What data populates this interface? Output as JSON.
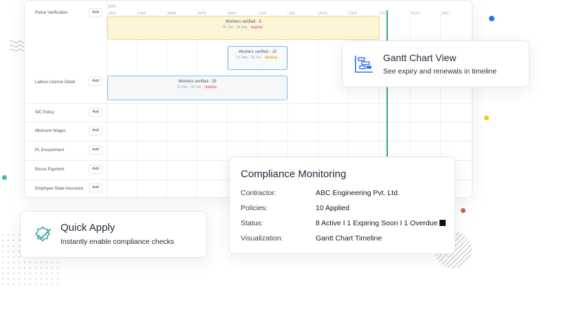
{
  "gantt": {
    "year": "2025",
    "months": [
      "JAN",
      "FEB",
      "MAR",
      "APR",
      "MAY",
      "JUN",
      "JUL",
      "AUG",
      "SEP",
      "OCT",
      "NOV",
      "DEC"
    ],
    "rows": [
      {
        "label": "Police Verification",
        "add": "Add"
      },
      {
        "label": "Labour License Detail",
        "add": "Add"
      },
      {
        "label": "WC Policy",
        "add": "Add"
      },
      {
        "label": "Minimum Wages",
        "add": "Add"
      },
      {
        "label": "PL Encashment",
        "add": "Add"
      },
      {
        "label": "Bonus Payment",
        "add": "Add"
      },
      {
        "label": "Employee State Insurance",
        "add": "Add"
      }
    ],
    "bars": [
      {
        "title": "Workers verified - 5",
        "dates": "01 Jan - 30 Sep",
        "status": "Expired"
      },
      {
        "title": "Workers verified - 10",
        "dates": "01 May - 30 Jun",
        "status": "Pending"
      },
      {
        "title": "Workers verified - 25",
        "dates": "01 Nov - 30 Jun",
        "status": "Expired"
      }
    ],
    "colors": {
      "today_line": "#2fa486",
      "expired": "#d64545",
      "pending": "#c79a12"
    }
  },
  "gantt_card": {
    "title": "Gantt Chart View",
    "subtitle": "See expiry and renewals in timeline",
    "icon": "gantt-chart-icon"
  },
  "monitor_card": {
    "title": "Compliance Monitoring",
    "rows": [
      {
        "key": "Contractor:",
        "value": "ABC Engineering Pvt. Ltd."
      },
      {
        "key": "Policies:",
        "value": "10 Applied"
      },
      {
        "key": "Status:",
        "value": "8 Active I 1 Expiring Soon I 1 Overdue"
      },
      {
        "key": "Visualization:",
        "value": "Gantt Chart Timeline"
      }
    ]
  },
  "quick_card": {
    "title": "Quick Apply",
    "subtitle": "Instantly enable compliance checks",
    "icon": "check-badge-icon"
  }
}
